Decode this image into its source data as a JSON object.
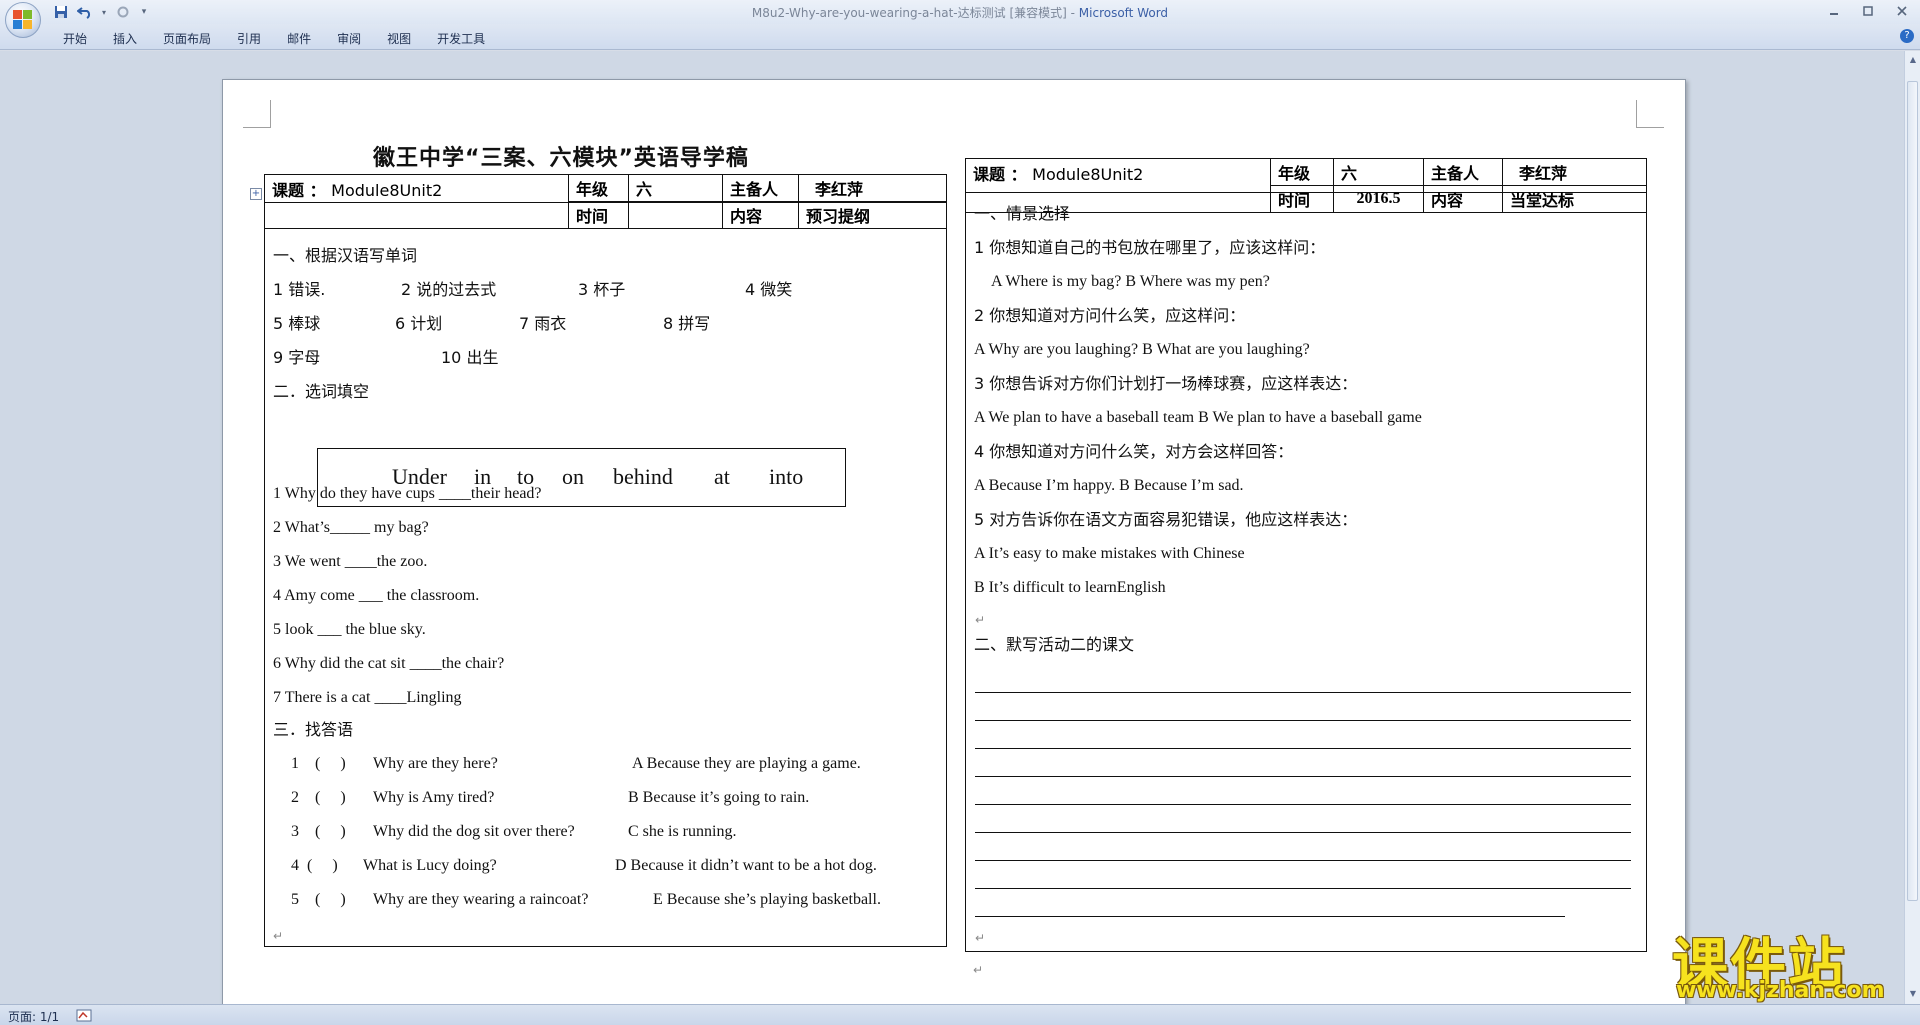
{
  "window": {
    "title_doc": "M8u2-Why-are-you-wearing-a-hat-达标测试 [兼容模式] - ",
    "title_app": "Microsoft Word"
  },
  "ribbon": {
    "tabs": [
      "开始",
      "插入",
      "页面布局",
      "引用",
      "邮件",
      "审阅",
      "视图",
      "开发工具"
    ]
  },
  "status": {
    "page": "页面: 1/1"
  },
  "doc": {
    "title": "徽王中学“三案、六模块”英语导学稿",
    "left_table": {
      "topic_label": "课题 ：",
      "topic_value": "Module8Unit2",
      "grade_label": "年级",
      "grade_value": "六",
      "preparer_label": "主备人",
      "preparer_value": "李红萍",
      "time_label": "时间",
      "content_label": "内容",
      "content_value": "预习提纲"
    },
    "right_table": {
      "topic_label": "课题 ：",
      "topic_value": "Module8Unit2",
      "grade_label": "年级",
      "grade_value": "六",
      "preparer_label": "主备人",
      "preparer_value": "李红萍",
      "time_label": "时间",
      "time_value": "2016.5",
      "content_label": "内容",
      "content_value": "当堂达标"
    },
    "left": {
      "s1_heading": "一、根据汉语写单词",
      "vocab": [
        [
          "1 错误.",
          "2 说的过去式",
          "3 杯子",
          "4 微笑"
        ],
        [
          "5 棒球",
          "6 计划",
          "7 雨衣",
          "8 拼写"
        ],
        [
          "9 字母",
          "10 出生"
        ]
      ],
      "s2_heading": "二．选词填空",
      "word_bank": [
        "Under",
        "in",
        "to",
        "on",
        "behind",
        "at",
        "into"
      ],
      "fill": [
        "1 Why do they have cups ____their head?",
        "2 What’s_____ my bag?",
        "3 We went ____the zoo.",
        "4 Amy come ___ the classroom.",
        "5 look ___ the blue sky.",
        "6 Why did the cat sit ____the chair?",
        "7 There is a cat ____Lingling"
      ],
      "s3_heading": "三．找答语",
      "match": [
        {
          "num": "1",
          "q": "Why are they here?",
          "a": "A Because they are playing a game."
        },
        {
          "num": "2",
          "q": "Why is Amy tired?",
          "a": "B Because it’s going to rain."
        },
        {
          "num": "3",
          "q": "Why did the dog sit over there?",
          "a": "C she is running."
        },
        {
          "num": "4",
          "q": "What is Lucy doing?",
          "a": "D Because it didn’t want to be a hot dog."
        },
        {
          "num": "5",
          "q": "Why are they wearing a raincoat?",
          "a": "E Because she’s playing basketball."
        }
      ]
    },
    "right": {
      "s1_heading": "一、情景选择",
      "lines": [
        "1 你想知道自己的书包放在哪里了，应该这样问：",
        "A   Where is my bag?   B Where was my pen?",
        "2 你想知道对方问什么笑，应这样问：",
        "A   Why are you laughing?   B What are you laughing?",
        "3 你想告诉对方你们计划打一场棒球赛，应这样表达：",
        "A We plan to have a baseball team    B We plan to have a baseball game",
        "4 你想知道对方问什么笑，对方会这样回答：",
        "A Because I’m happy.    B Because I’m sad.",
        "5 对方告诉你在语文方面容易犯错误，他应这样表达：",
        "A It’s easy to make mistakes with Chinese",
        "B It’s difficult to learnEnglish"
      ],
      "s2_heading": "二、默写活动二的课文"
    }
  },
  "watermark": {
    "big": "课件站",
    "small": "www.kjzhan.com"
  }
}
